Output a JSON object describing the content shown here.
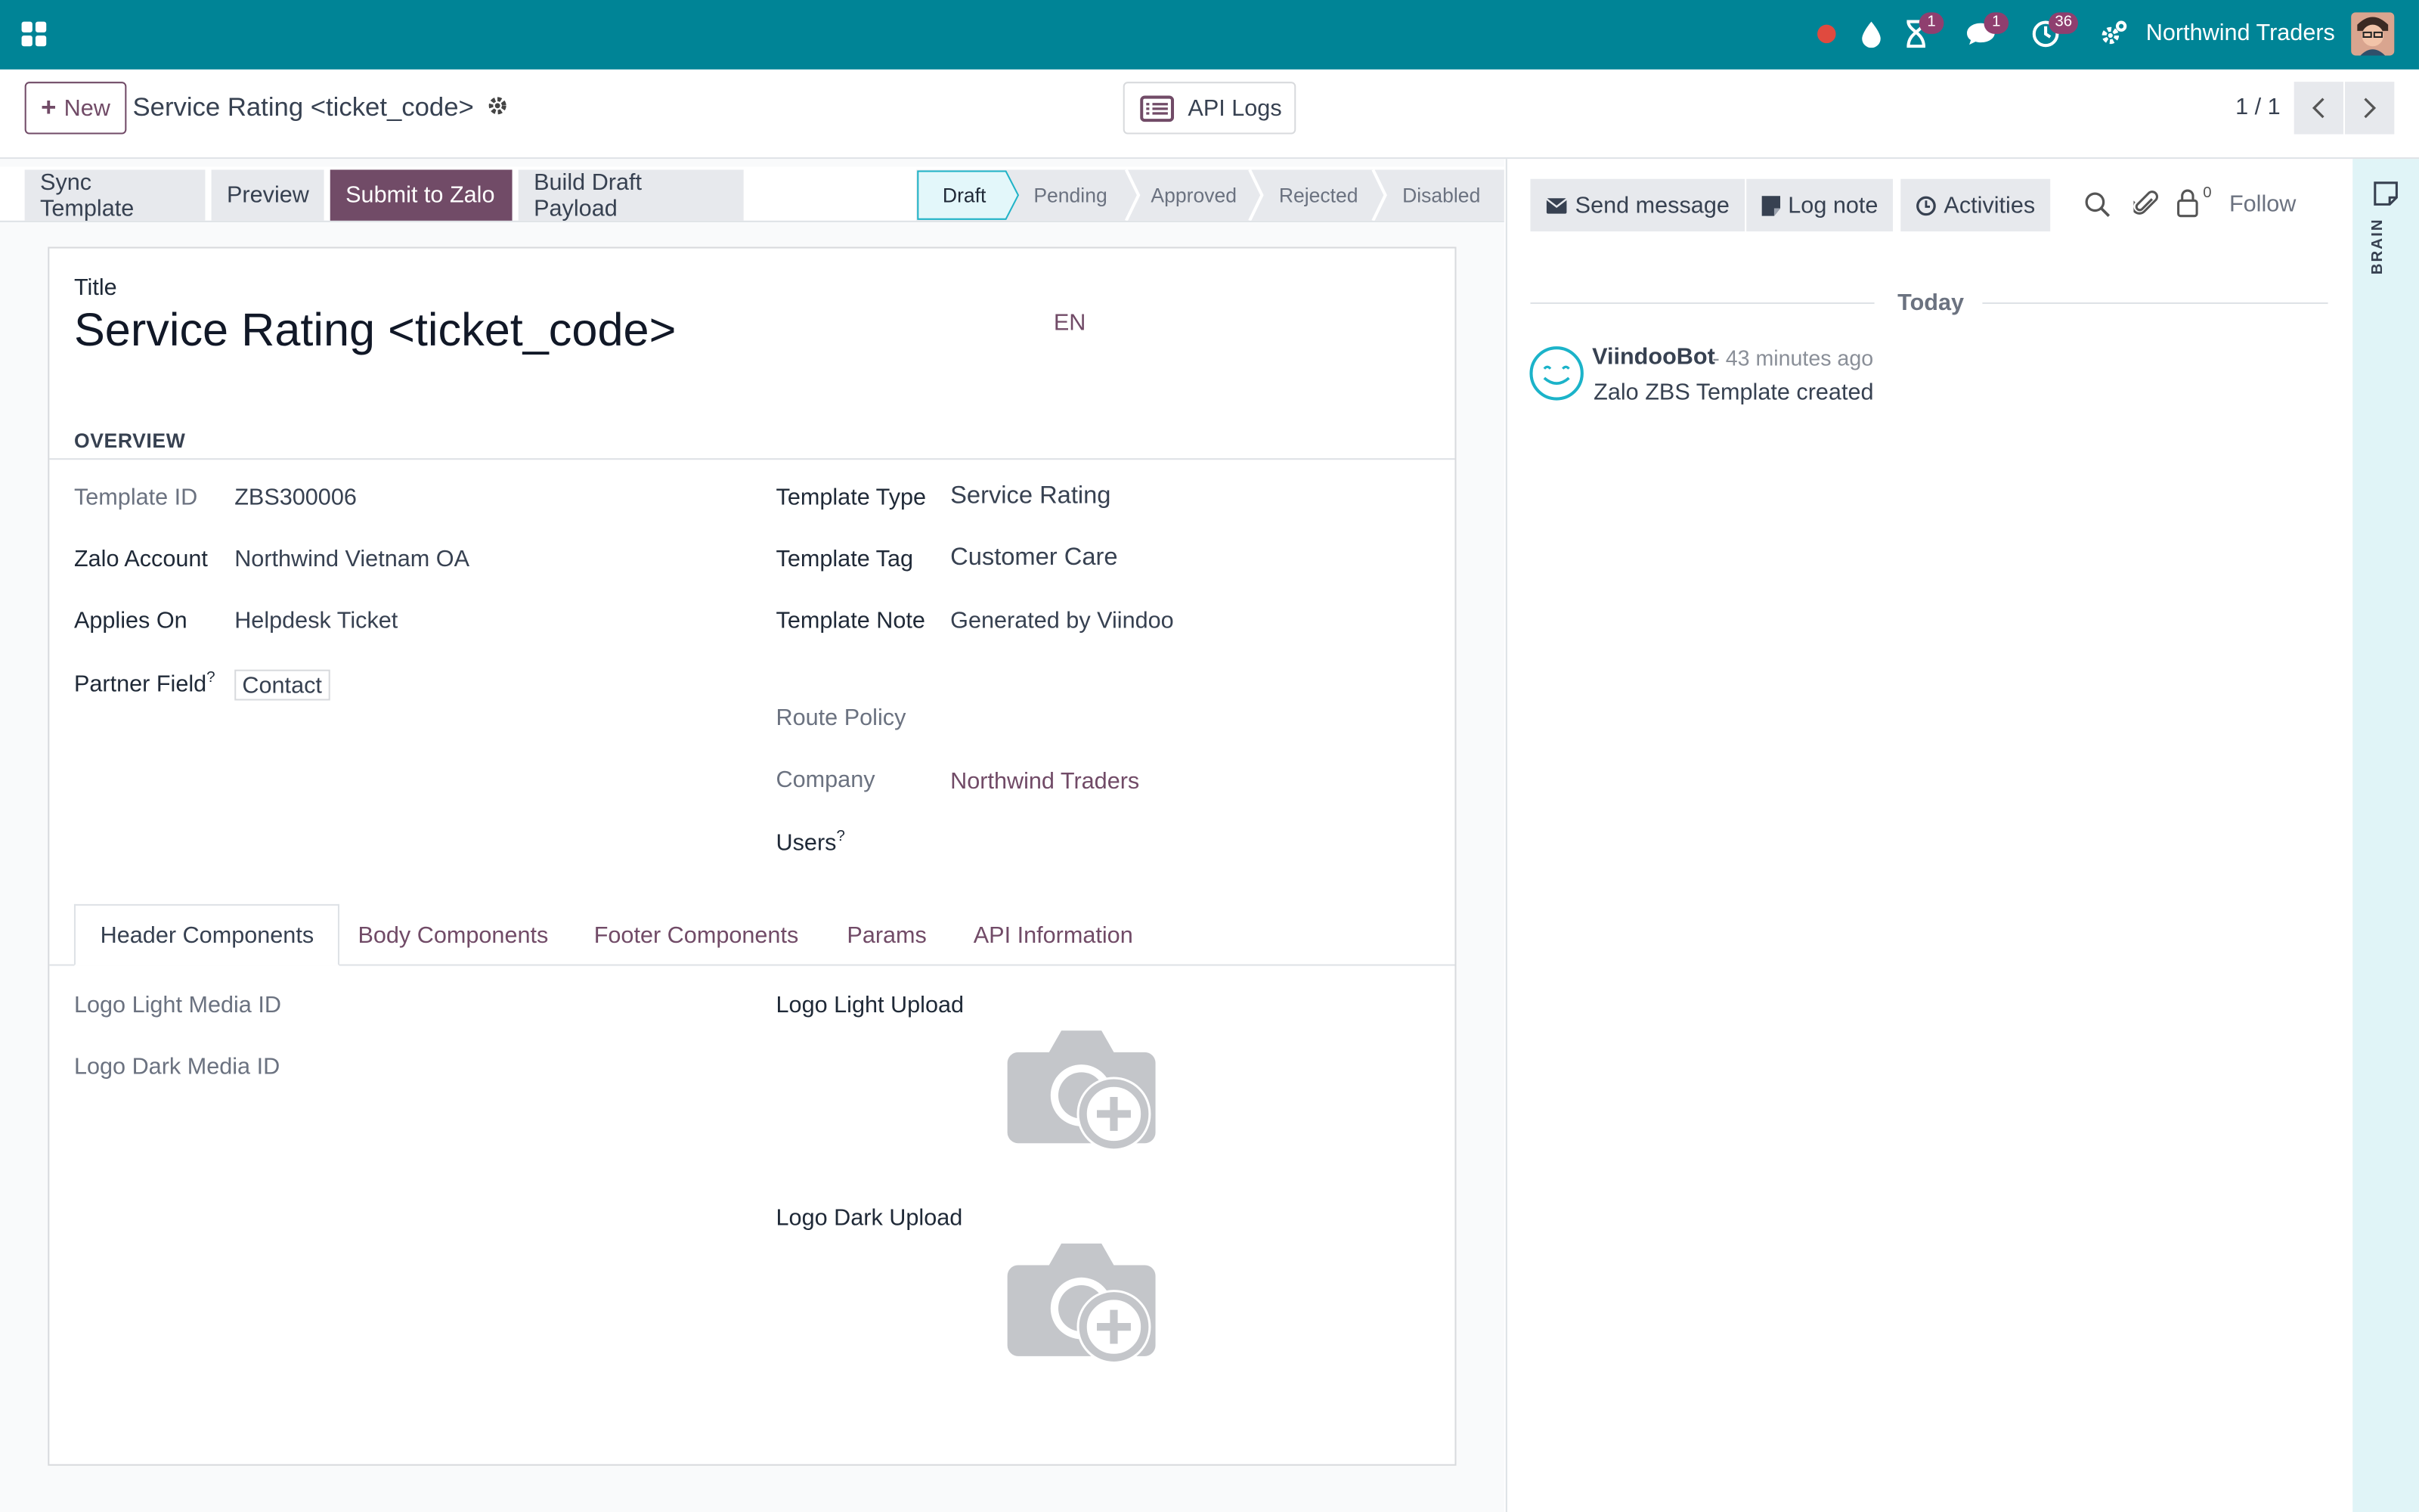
{
  "navbar": {
    "badges": {
      "activities": "1",
      "messages": "1",
      "clock": "36"
    },
    "company": "Northwind Traders",
    "icons": [
      "apps-grid-icon",
      "recording-dot-icon",
      "drop-icon",
      "hourglass-icon",
      "chat-icon",
      "clock-icon",
      "settings-icon"
    ]
  },
  "control": {
    "new_label": "New",
    "breadcrumb": "Service Rating <ticket_code>",
    "api_logs_label": "API Logs",
    "pager": "1 / 1"
  },
  "header_buttons": {
    "sync": "Sync Template",
    "preview": "Preview",
    "submit": "Submit to Zalo",
    "build": "Build Draft Payload"
  },
  "stages": [
    "Draft",
    "Pending",
    "Approved",
    "Rejected",
    "Disabled"
  ],
  "active_stage": "Draft",
  "form": {
    "title_label": "Title",
    "title": "Service Rating <ticket_code>",
    "lang": "EN",
    "overview": "OVERVIEW",
    "left": {
      "template_id_label": "Template ID",
      "template_id": "ZBS300006",
      "zalo_account_label": "Zalo Account",
      "zalo_account": "Northwind Vietnam OA",
      "applies_on_label": "Applies On",
      "applies_on": "Helpdesk Ticket",
      "partner_field_label": "Partner Field",
      "partner_field_help": "?",
      "partner_field": "Contact"
    },
    "right": {
      "template_type_label": "Template Type",
      "template_type": "Service Rating",
      "template_tag_label": "Template Tag",
      "template_tag": "Customer Care",
      "template_note_label": "Template Note",
      "template_note": "Generated by Viindoo",
      "route_policy_label": "Route Policy",
      "company_label": "Company",
      "company": "Northwind Traders",
      "users_label": "Users",
      "users_help": "?"
    },
    "tabs": [
      "Header Components",
      "Body Components",
      "Footer Components",
      "Params",
      "API Information"
    ],
    "active_tab": "Header Components",
    "header_components": {
      "logo_light_media_label": "Logo Light Media ID",
      "logo_dark_media_label": "Logo Dark Media ID",
      "logo_light_upload_label": "Logo Light Upload",
      "logo_dark_upload_label": "Logo Dark Upload"
    }
  },
  "chatter": {
    "send_message": "Send message",
    "log_note": "Log note",
    "activities": "Activities",
    "followers_count": "0",
    "follow": "Follow",
    "today": "Today",
    "messages": [
      {
        "author": "ViindooBot",
        "time": "- 43 minutes ago",
        "body": "Zalo ZBS Template created"
      }
    ]
  },
  "side_panel": {
    "label": "BRAIN"
  }
}
